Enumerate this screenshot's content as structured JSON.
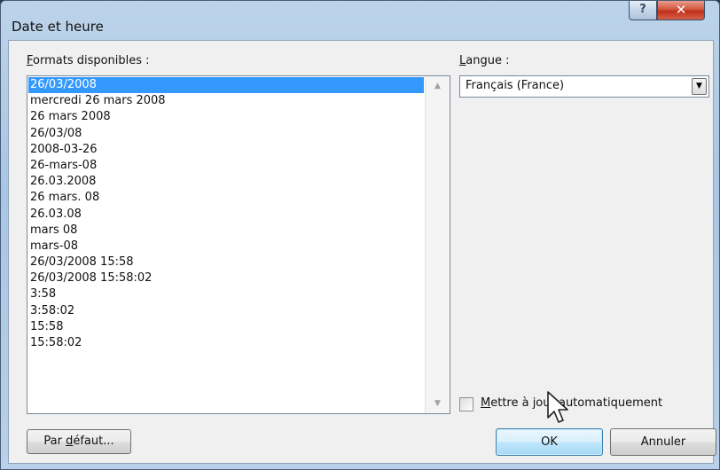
{
  "window": {
    "title": "Date et heure",
    "help_glyph": "?",
    "close_glyph": "✕"
  },
  "formats": {
    "label_accel": "F",
    "label_rest": "ormats disponibles :",
    "selected_index": 0,
    "items": [
      "26/03/2008",
      "mercredi 26 mars 2008",
      "26 mars 2008",
      "26/03/08",
      "2008-03-26",
      "26-mars-08",
      "26.03.2008",
      "26 mars. 08",
      "26.03.08",
      "mars 08",
      "mars-08",
      "26/03/2008 15:58",
      "26/03/2008 15:58:02",
      "3:58",
      "3:58:02",
      "15:58",
      "15:58:02"
    ]
  },
  "language": {
    "label_accel": "L",
    "label_rest": "angue :",
    "value": "Français (France)"
  },
  "auto_update": {
    "label_accel": "M",
    "label_rest": "ettre à jour automatiquement",
    "checked": false
  },
  "buttons": {
    "default_pre": "Par ",
    "default_accel": "d",
    "default_post": "éfaut...",
    "ok": "OK",
    "cancel": "Annuler"
  },
  "icons": {
    "help": "help-icon",
    "close": "close-icon",
    "scroll_up": "scroll-up-arrow-icon",
    "scroll_down": "scroll-down-arrow-icon",
    "dropdown": "chevron-down-icon",
    "cursor": "mouse-pointer-icon"
  }
}
